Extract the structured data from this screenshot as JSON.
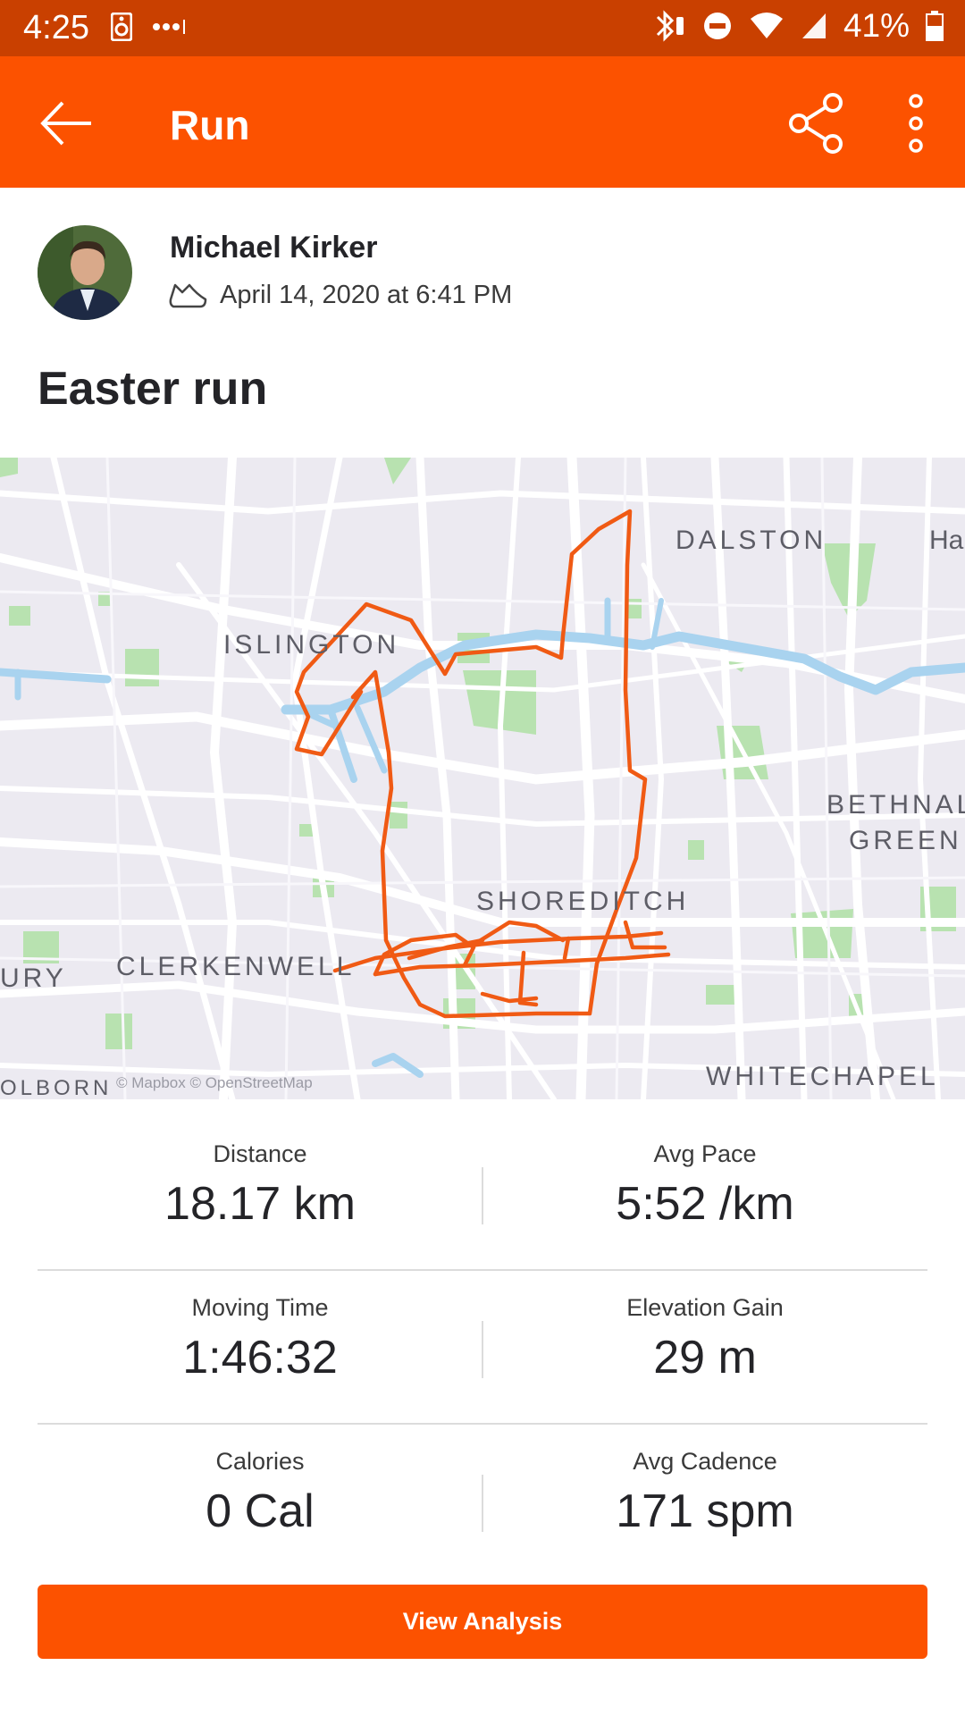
{
  "status_bar": {
    "time": "4:25",
    "battery": "41%"
  },
  "app_bar": {
    "title": "Run"
  },
  "activity": {
    "athlete_name": "Michael Kirker",
    "date": "April 14, 2020 at 6:41 PM",
    "title": "Easter run"
  },
  "map": {
    "labels": {
      "dalston": "DALSTON",
      "islington": "ISLINGTON",
      "bethnal_1": "BETHNAL",
      "bethnal_2": "GREEN",
      "shoreditch": "SHOREDITCH",
      "clerkenwell": "CLERKENWELL",
      "whitechapel": "WHITECHAPEL",
      "ha": "Ha",
      "ury": "URY",
      "olborn": "OLBORN"
    },
    "attribution": "© Mapbox © OpenStreetMap"
  },
  "stats": [
    {
      "label": "Distance",
      "value": "18.17 km"
    },
    {
      "label": "Avg Pace",
      "value": "5:52 /km"
    },
    {
      "label": "Moving Time",
      "value": "1:46:32"
    },
    {
      "label": "Elevation Gain",
      "value": "29 m"
    },
    {
      "label": "Calories",
      "value": "0 Cal"
    },
    {
      "label": "Avg Cadence",
      "value": "171 spm"
    }
  ],
  "analysis_button": {
    "label": "View Analysis"
  },
  "colors": {
    "brand": "#fc5200",
    "status_bar": "#c94000",
    "route": "#f05a14"
  }
}
